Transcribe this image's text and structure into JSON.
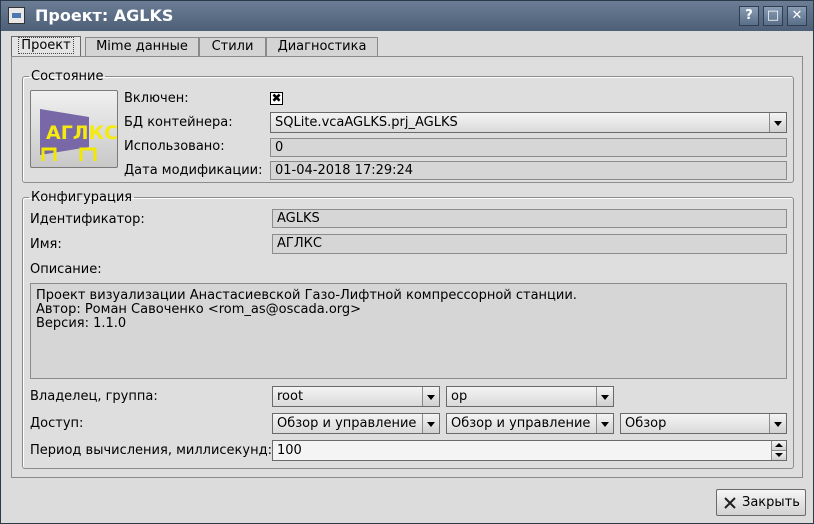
{
  "window": {
    "title": "Проект: AGLKS",
    "buttons": {
      "help": "?",
      "maximize": "□",
      "close": "✕"
    }
  },
  "tabs": [
    "Проект",
    "Mime данные",
    "Стили",
    "Диагностика"
  ],
  "active_tab": "Проект",
  "state": {
    "legend": "Состояние",
    "enabled_label": "Включен:",
    "enabled": true,
    "db_label": "БД контейнера:",
    "db_value": "SQLite.vcaAGLKS.prj_AGLKS",
    "used_label": "Использовано:",
    "used_value": "0",
    "modified_label": "Дата модификации:",
    "modified_value": "01-04-2018 17:29:24",
    "icon_text": "АГЛКС"
  },
  "config": {
    "legend": "Конфигурация",
    "id_label": "Идентификатор:",
    "id_value": "AGLKS",
    "name_label": "Имя:",
    "name_value": "АГЛКС",
    "descr_label": "Описание:",
    "descr_value": "Проект визуализации Анастасиевской Газо-Лифтной компрессорной станции.\nАвтор: Роман Савоченко <rom_as@oscada.org>\nВерсия: 1.1.0",
    "owner_label": "Владелец, группа:",
    "owner_value": "root",
    "group_value": "op",
    "access_label": "Доступ:",
    "access_owner": "Обзор и управление",
    "access_group": "Обзор и управление",
    "access_other": "Обзор",
    "period_label": "Период вычисления, миллисекунд:",
    "period_value": "100"
  },
  "close_button": "Закрыть",
  "colors": {
    "titlebar": "#5a6e88",
    "window_bg": "#dcdcdc",
    "icon_yellow": "#f0e800",
    "icon_purple": "#7060a0"
  }
}
